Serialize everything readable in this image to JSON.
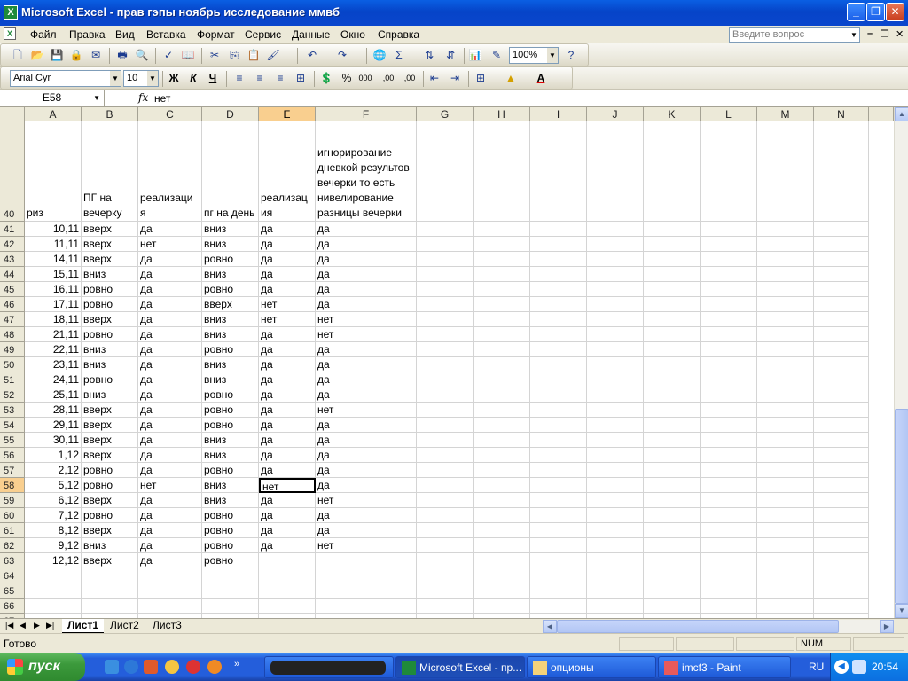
{
  "window": {
    "title": "Microsoft Excel - прав гэпы ноябрь исследование ммвб",
    "app_icon": "excel-icon"
  },
  "menu": [
    "Файл",
    "Правка",
    "Вид",
    "Вставка",
    "Формат",
    "Сервис",
    "Данные",
    "Окно",
    "Справка"
  ],
  "ask": {
    "placeholder": "Введите вопрос"
  },
  "toolbar": {
    "zoom": "100%",
    "font": "Arial Cyr",
    "size": "10",
    "bold": "Ж",
    "italic": "К",
    "underline": "Ч",
    "sum": "Σ",
    "percent": "%",
    "thousands": "000",
    "inc_dec": ",00",
    "dec_dec": ",00",
    "font_color_letter": "A"
  },
  "formula": {
    "name_box": "E58",
    "fx": "fx",
    "value": "нет"
  },
  "columns": [
    "A",
    "B",
    "C",
    "D",
    "E",
    "F",
    "G",
    "H",
    "I",
    "J",
    "K",
    "L",
    "M",
    "N"
  ],
  "header_row": {
    "num": "40",
    "A": "риз",
    "B": "ПГ на вечерку",
    "C": "реализаци я",
    "D": "пг на день",
    "E": "реализац ия",
    "F": "игнорирование дневкой результов вечерки то есть нивелирование разницы вечерки"
  },
  "rows": [
    {
      "n": "41",
      "a": "10,11",
      "b": "вверх",
      "c": "да",
      "d": "вниз",
      "e": "да",
      "f": "да"
    },
    {
      "n": "42",
      "a": "11,11",
      "b": "вверх",
      "c": "нет",
      "d": "вниз",
      "e": "да",
      "f": "да"
    },
    {
      "n": "43",
      "a": "14,11",
      "b": "вверх",
      "c": "да",
      "d": "ровно",
      "e": "да",
      "f": "да"
    },
    {
      "n": "44",
      "a": "15,11",
      "b": "вниз",
      "c": "да",
      "d": "вниз",
      "e": "да",
      "f": "да"
    },
    {
      "n": "45",
      "a": "16,11",
      "b": "ровно",
      "c": "да",
      "d": "ровно",
      "e": "да",
      "f": "да"
    },
    {
      "n": "46",
      "a": "17,11",
      "b": "ровно",
      "c": "да",
      "d": "вверх",
      "e": "нет",
      "f": "да"
    },
    {
      "n": "47",
      "a": "18,11",
      "b": "вверх",
      "c": "да",
      "d": "вниз",
      "e": "нет",
      "f": "нет"
    },
    {
      "n": "48",
      "a": "21,11",
      "b": "ровно",
      "c": "да",
      "d": "вниз",
      "e": "да",
      "f": "нет"
    },
    {
      "n": "49",
      "a": "22,11",
      "b": "вниз",
      "c": "да",
      "d": "ровно",
      "e": "да",
      "f": "да"
    },
    {
      "n": "50",
      "a": "23,11",
      "b": "вниз",
      "c": "да",
      "d": "вниз",
      "e": "да",
      "f": "да"
    },
    {
      "n": "51",
      "a": "24,11",
      "b": "ровно",
      "c": "да",
      "d": "вниз",
      "e": "да",
      "f": "да"
    },
    {
      "n": "52",
      "a": "25,11",
      "b": "вниз",
      "c": "да",
      "d": "ровно",
      "e": "да",
      "f": "да"
    },
    {
      "n": "53",
      "a": "28,11",
      "b": "вверх",
      "c": "да",
      "d": "ровно",
      "e": "да",
      "f": "нет"
    },
    {
      "n": "54",
      "a": "29,11",
      "b": "вверх",
      "c": "да",
      "d": "ровно",
      "e": "да",
      "f": "да"
    },
    {
      "n": "55",
      "a": "30,11",
      "b": "вверх",
      "c": "да",
      "d": "вниз",
      "e": "да",
      "f": "да"
    },
    {
      "n": "56",
      "a": "1,12",
      "b": "вверх",
      "c": "да",
      "d": "вниз",
      "e": "да",
      "f": "да"
    },
    {
      "n": "57",
      "a": "2,12",
      "b": "ровно",
      "c": "да",
      "d": "ровно",
      "e": "да",
      "f": "да"
    },
    {
      "n": "58",
      "a": "5,12",
      "b": "ровно",
      "c": "нет",
      "d": "вниз",
      "e": "нет",
      "f": "да"
    },
    {
      "n": "59",
      "a": "6,12",
      "b": "вверх",
      "c": "да",
      "d": "вниз",
      "e": "да",
      "f": "нет"
    },
    {
      "n": "60",
      "a": "7,12",
      "b": "ровно",
      "c": "да",
      "d": "ровно",
      "e": "да",
      "f": "да"
    },
    {
      "n": "61",
      "a": "8,12",
      "b": "вверх",
      "c": "да",
      "d": "ровно",
      "e": "да",
      "f": "да"
    },
    {
      "n": "62",
      "a": "9,12",
      "b": "вниз",
      "c": "да",
      "d": "ровно",
      "e": "да",
      "f": "нет"
    },
    {
      "n": "63",
      "a": "12,12",
      "b": "вверх",
      "c": "да",
      "d": "ровно",
      "e": "",
      "f": ""
    },
    {
      "n": "64",
      "a": "",
      "b": "",
      "c": "",
      "d": "",
      "e": "",
      "f": ""
    },
    {
      "n": "65",
      "a": "",
      "b": "",
      "c": "",
      "d": "",
      "e": "",
      "f": ""
    },
    {
      "n": "66",
      "a": "",
      "b": "",
      "c": "",
      "d": "",
      "e": "",
      "f": ""
    },
    {
      "n": "67",
      "a": "",
      "b": "",
      "c": "",
      "d": "",
      "e": "",
      "f": ""
    }
  ],
  "active_cell": {
    "row": "58",
    "col": "E"
  },
  "sheets": [
    "Лист1",
    "Лист2",
    "Лист3"
  ],
  "active_sheet": "Лист1",
  "status": {
    "text": "Готово",
    "num": "NUM"
  },
  "taskbar": {
    "start": "пуск",
    "tasks": [
      {
        "label": "",
        "icon": "redacted-icon",
        "active": false
      },
      {
        "label": "Microsoft Excel - пр...",
        "icon": "excel-icon",
        "active": true
      },
      {
        "label": "опционы",
        "icon": "folder-icon",
        "active": false
      },
      {
        "label": "imcf3 - Paint",
        "icon": "paint-icon",
        "active": false
      }
    ],
    "lang": "RU",
    "clock": "20:54"
  },
  "colors": {
    "title_blue": "#0a5fe3",
    "selected_header": "#f9cf8f",
    "start_green": "#3c9a3c",
    "taskbar_blue": "#245edb"
  }
}
